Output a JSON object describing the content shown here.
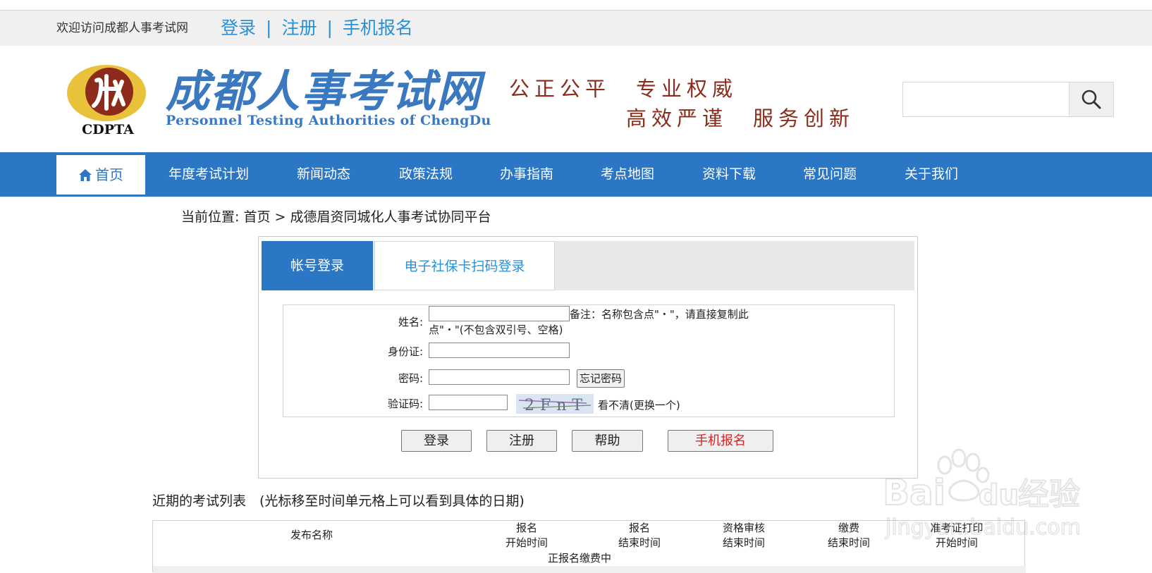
{
  "topbar": {
    "welcome": "欢迎访问成都人事考试网",
    "links": [
      "登录",
      "注册",
      "手机报名"
    ]
  },
  "header": {
    "logo_text": "CDPTA",
    "site_title": "成都人事考试网",
    "site_subtitle": "Personnel Testing Authorities of ChengDu",
    "slogan_line1": "公正公平　专业权威",
    "slogan_line2": "高效严谨　服务创新",
    "search_placeholder": ""
  },
  "nav": {
    "home": "首页",
    "items": [
      "年度考试计划",
      "新闻动态",
      "政策法规",
      "办事指南",
      "考点地图",
      "资料下载",
      "常见问题",
      "关于我们"
    ]
  },
  "breadcrumb": "当前位置: 首页 > 成德眉资同城化人事考试协同平台",
  "login": {
    "tabs": [
      "帐号登录",
      "电子社保卡扫码登录"
    ],
    "fields": {
      "name_label": "姓名:",
      "id_label": "身份证:",
      "password_label": "密码:",
      "captcha_label": "验证码:"
    },
    "note": "备注：名称包含点\"・\"，请直接复制此点\"・\"(不包含双引号、空格)",
    "forgot_password": "忘记密码",
    "captcha_text": "2FnT",
    "captcha_refresh": "看不清(更换一个)",
    "buttons": {
      "login": "登录",
      "register": "注册",
      "help": "帮助",
      "mobile": "手机报名"
    }
  },
  "exam_list": {
    "title": "近期的考试列表　(光标移至时间单元格上可以看到具体的日期)",
    "headers": [
      {
        "line1": "发布名称",
        "line2": ""
      },
      {
        "line1": "报名",
        "line2": "开始时间"
      },
      {
        "line1": "报名",
        "line2": "结束时间"
      },
      {
        "line1": "资格审核",
        "line2": "结束时间"
      },
      {
        "line1": "缴费",
        "line2": "结束时间"
      },
      {
        "line1": "准考证打印",
        "line2": "开始时间"
      }
    ],
    "status": "正报名缴费中"
  },
  "watermark": {
    "brand": "Bai",
    "brand2": "du",
    "cn": "经验",
    "url": "jingyan.baidu.com"
  },
  "colors": {
    "nav_blue": "#2b77c6",
    "link_blue": "#2a90d4",
    "slogan_red": "#8b2b1b",
    "mobile_red": "#e02020"
  }
}
